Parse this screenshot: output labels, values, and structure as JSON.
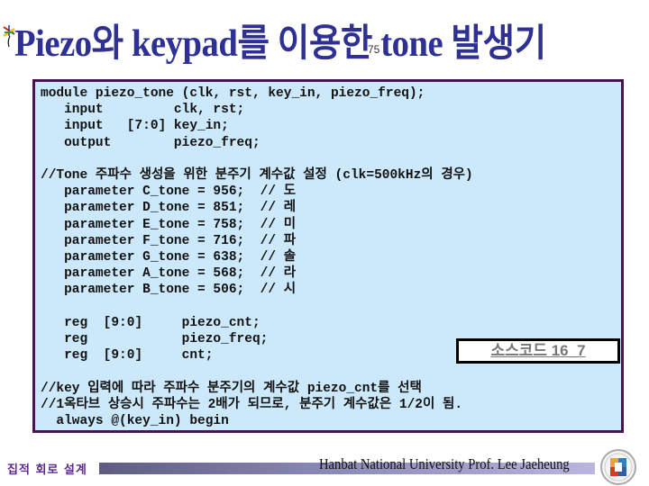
{
  "header": {
    "title": "Piezo와 keypad를 이용한 tone 발생기",
    "page_number": "75",
    "logo_icon": "colorful-star-logo"
  },
  "code": {
    "lines": [
      "module piezo_tone (clk, rst, key_in, piezo_freq);",
      "   input         clk, rst;",
      "   input   [7:0] key_in;",
      "   output        piezo_freq;",
      "",
      "//Tone 주파수 생성을 위한 분주기 계수값 설정 (clk=500kHz의 경우)",
      "   parameter C_tone = 956;  // 도",
      "   parameter D_tone = 851;  // 레",
      "   parameter E_tone = 758;  // 미",
      "   parameter F_tone = 716;  // 파",
      "   parameter G_tone = 638;  // 솔",
      "   parameter A_tone = 568;  // 라",
      "   parameter B_tone = 506;  // 시",
      "",
      "   reg  [9:0]     piezo_cnt;",
      "   reg            piezo_freq;",
      "   reg  [9:0]     cnt;",
      "",
      "//key 입력에 따라 주파수 분주기의 계수값 piezo_cnt를 선택",
      "//1옥타브 상승시 주파수는 2배가 되므로, 분주기 계수값은 1/2이 됨.",
      "  always @(key_in) begin"
    ]
  },
  "source_label": "소스코드 16_7",
  "footer": {
    "left_text": "집적 회로 설계",
    "right_text": "Hanbat National University Prof. Lee Jaeheung",
    "emblem_icon": "university-emblem"
  }
}
